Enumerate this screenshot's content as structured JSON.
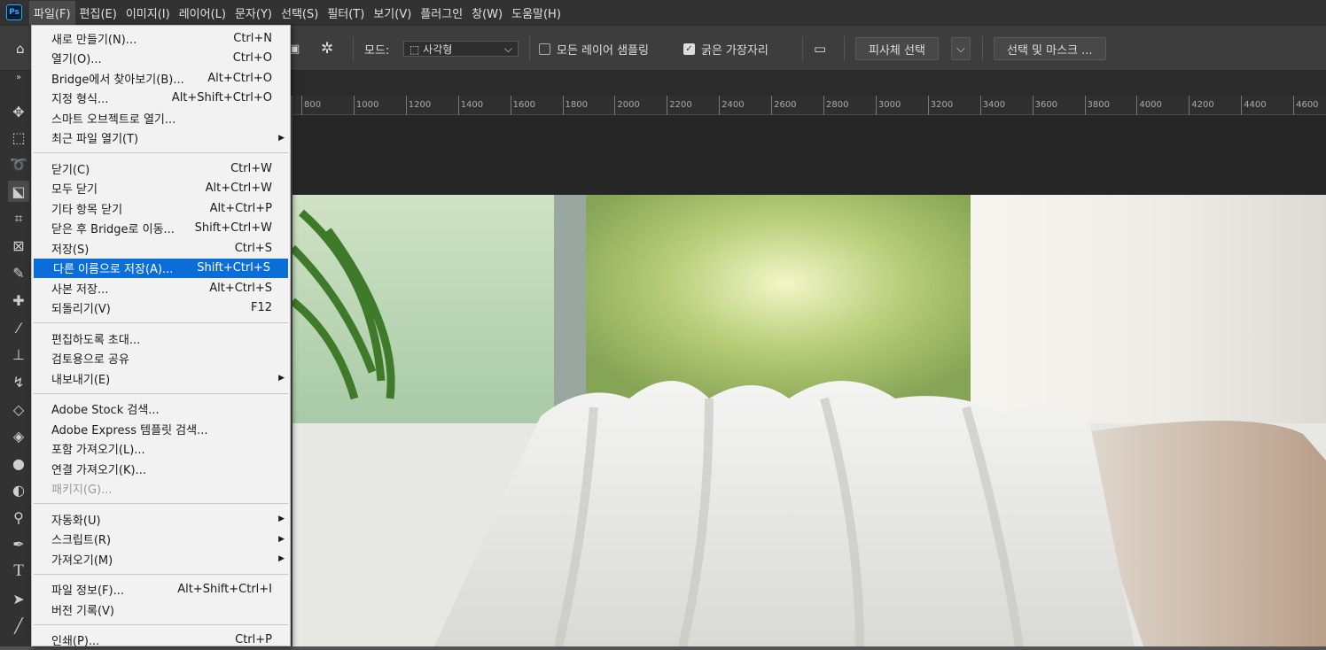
{
  "menubar": {
    "logo": "Ps",
    "items": [
      "파일(F)",
      "편집(E)",
      "이미지(I)",
      "레이어(L)",
      "문자(Y)",
      "선택(S)",
      "필터(T)",
      "보기(V)",
      "플러그인",
      "창(W)",
      "도움말(H)"
    ]
  },
  "options": {
    "mode_label": "모드:",
    "mode_value": "사각형",
    "sample_all": "모든 레이어 샘플링",
    "hard_edge": "굵은 가장자리",
    "subject_btn": "피사체 선택",
    "mask_btn": "선택 및 마스크 ..."
  },
  "ruler": [
    "800",
    "1000",
    "1200",
    "1400",
    "1600",
    "1800",
    "2000",
    "2200",
    "2400",
    "2600",
    "2800",
    "3000",
    "3200",
    "3400",
    "3600",
    "3800",
    "4000",
    "4200",
    "4400",
    "4600"
  ],
  "file_menu": {
    "g1": [
      {
        "label": "새로 만들기(N)...",
        "shortcut": "Ctrl+N"
      },
      {
        "label": "열기(O)...",
        "shortcut": "Ctrl+O"
      },
      {
        "label": "Bridge에서 찾아보기(B)...",
        "shortcut": "Alt+Ctrl+O"
      },
      {
        "label": "지정 형식...",
        "shortcut": "Alt+Shift+Ctrl+O"
      },
      {
        "label": "스마트 오브젝트로 열기...",
        "shortcut": ""
      },
      {
        "label": "최근 파일 열기(T)",
        "shortcut": ""
      }
    ],
    "g2": [
      {
        "label": "닫기(C)",
        "shortcut": "Ctrl+W"
      },
      {
        "label": "모두 닫기",
        "shortcut": "Alt+Ctrl+W"
      },
      {
        "label": "기타 항목 닫기",
        "shortcut": "Alt+Ctrl+P"
      },
      {
        "label": "닫은 후 Bridge로 이동...",
        "shortcut": "Shift+Ctrl+W"
      },
      {
        "label": "저장(S)",
        "shortcut": "Ctrl+S"
      },
      {
        "label": "다른 이름으로 저장(A)...",
        "shortcut": "Shift+Ctrl+S"
      },
      {
        "label": "사본 저장...",
        "shortcut": "Alt+Ctrl+S"
      },
      {
        "label": "되돌리기(V)",
        "shortcut": "F12"
      }
    ],
    "g3": [
      {
        "label": "편집하도록 초대...",
        "shortcut": ""
      },
      {
        "label": "검토용으로 공유",
        "shortcut": ""
      },
      {
        "label": "내보내기(E)",
        "shortcut": ""
      }
    ],
    "g4": [
      {
        "label": "Adobe Stock 검색...",
        "shortcut": ""
      },
      {
        "label": "Adobe Express 템플릿 검색...",
        "shortcut": ""
      },
      {
        "label": "포함 가져오기(L)...",
        "shortcut": ""
      },
      {
        "label": "연결 가져오기(K)...",
        "shortcut": ""
      },
      {
        "label": "패키지(G)...",
        "shortcut": ""
      }
    ],
    "g5": [
      {
        "label": "자동화(U)",
        "shortcut": ""
      },
      {
        "label": "스크립트(R)",
        "shortcut": ""
      },
      {
        "label": "가져오기(M)",
        "shortcut": ""
      }
    ],
    "g6": [
      {
        "label": "파일 정보(F)...",
        "shortcut": "Alt+Shift+Ctrl+I"
      },
      {
        "label": "버전 기록(V)",
        "shortcut": ""
      }
    ],
    "g7": [
      {
        "label": "인쇄(P)...",
        "shortcut": "Ctrl+P"
      }
    ]
  }
}
